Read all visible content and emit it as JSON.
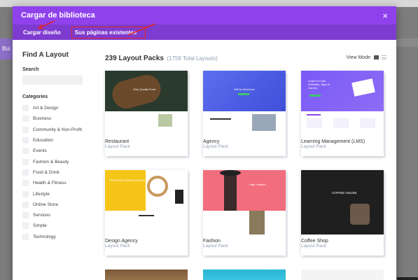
{
  "modal": {
    "title": "Cargar de biblioteca",
    "close_glyph": "×"
  },
  "tabs": [
    {
      "label": "Cargar diseño",
      "active": true
    },
    {
      "label": "Sus páginas existentes",
      "active": false
    }
  ],
  "background": {
    "strip_text": "Bui"
  },
  "sidebar": {
    "title": "Find A Layout",
    "search_label": "Search",
    "search_value": "",
    "categories_label": "Categories",
    "categories": [
      "Art & Design",
      "Business",
      "Community & Non-Profit",
      "Education",
      "Events",
      "Fashion & Beauty",
      "Food & Drink",
      "Health & Fitness",
      "Lifestyle",
      "Online Store",
      "Services",
      "Simple",
      "Technology"
    ]
  },
  "content": {
    "packs_title": "239 Layout Packs",
    "packs_total": "(1759 Total Layouts)",
    "view_mode_label": "View Mode",
    "cards": [
      {
        "name": "Restaurant",
        "sub": "Layout Pack"
      },
      {
        "name": "Agency",
        "sub": "Layout Pack"
      },
      {
        "name": "Learning Management (LMS)",
        "sub": "Layout Pack"
      },
      {
        "name": "Design Agency",
        "sub": "Layout Pack"
      },
      {
        "name": "Fashion",
        "sub": "Layout Pack"
      },
      {
        "name": "Coffee Shop",
        "sub": "Layout Pack"
      }
    ],
    "thumb_texts": {
      "restaurant": "Only Quality Food",
      "agency": "Grit for Business",
      "lms": "Learn to Code Websites, Apps & Games",
      "design": "CREATIVE DESIGN AGENCY",
      "fashion": "High Fashion",
      "coffee": "COFFEE HOUSE"
    }
  },
  "colors": {
    "header_purple": "#8f42ec",
    "tabs_purple": "#7e3bd0",
    "annotation_red": "#e02424",
    "muted_text": "#8f9bb3"
  }
}
